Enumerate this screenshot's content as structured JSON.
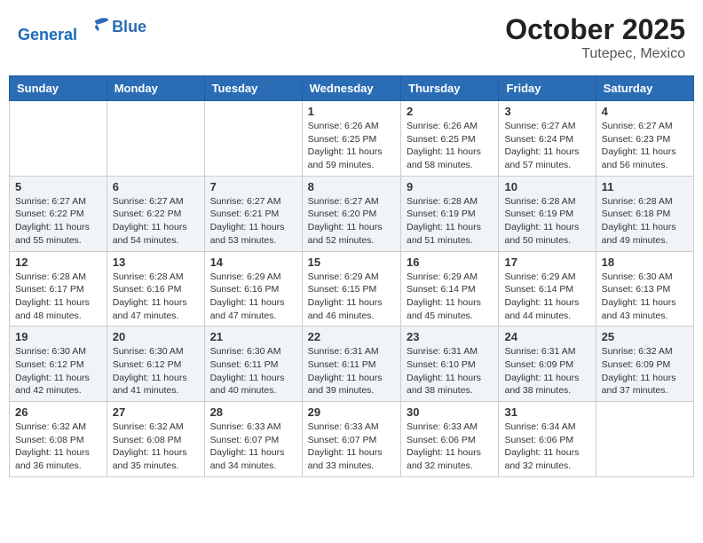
{
  "header": {
    "logo_line1": "General",
    "logo_line2": "Blue",
    "month": "October 2025",
    "location": "Tutepec, Mexico"
  },
  "weekdays": [
    "Sunday",
    "Monday",
    "Tuesday",
    "Wednesday",
    "Thursday",
    "Friday",
    "Saturday"
  ],
  "weeks": [
    [
      {
        "day": "",
        "info": ""
      },
      {
        "day": "",
        "info": ""
      },
      {
        "day": "",
        "info": ""
      },
      {
        "day": "1",
        "info": "Sunrise: 6:26 AM\nSunset: 6:25 PM\nDaylight: 11 hours and 59 minutes."
      },
      {
        "day": "2",
        "info": "Sunrise: 6:26 AM\nSunset: 6:25 PM\nDaylight: 11 hours and 58 minutes."
      },
      {
        "day": "3",
        "info": "Sunrise: 6:27 AM\nSunset: 6:24 PM\nDaylight: 11 hours and 57 minutes."
      },
      {
        "day": "4",
        "info": "Sunrise: 6:27 AM\nSunset: 6:23 PM\nDaylight: 11 hours and 56 minutes."
      }
    ],
    [
      {
        "day": "5",
        "info": "Sunrise: 6:27 AM\nSunset: 6:22 PM\nDaylight: 11 hours and 55 minutes."
      },
      {
        "day": "6",
        "info": "Sunrise: 6:27 AM\nSunset: 6:22 PM\nDaylight: 11 hours and 54 minutes."
      },
      {
        "day": "7",
        "info": "Sunrise: 6:27 AM\nSunset: 6:21 PM\nDaylight: 11 hours and 53 minutes."
      },
      {
        "day": "8",
        "info": "Sunrise: 6:27 AM\nSunset: 6:20 PM\nDaylight: 11 hours and 52 minutes."
      },
      {
        "day": "9",
        "info": "Sunrise: 6:28 AM\nSunset: 6:19 PM\nDaylight: 11 hours and 51 minutes."
      },
      {
        "day": "10",
        "info": "Sunrise: 6:28 AM\nSunset: 6:19 PM\nDaylight: 11 hours and 50 minutes."
      },
      {
        "day": "11",
        "info": "Sunrise: 6:28 AM\nSunset: 6:18 PM\nDaylight: 11 hours and 49 minutes."
      }
    ],
    [
      {
        "day": "12",
        "info": "Sunrise: 6:28 AM\nSunset: 6:17 PM\nDaylight: 11 hours and 48 minutes."
      },
      {
        "day": "13",
        "info": "Sunrise: 6:28 AM\nSunset: 6:16 PM\nDaylight: 11 hours and 47 minutes."
      },
      {
        "day": "14",
        "info": "Sunrise: 6:29 AM\nSunset: 6:16 PM\nDaylight: 11 hours and 47 minutes."
      },
      {
        "day": "15",
        "info": "Sunrise: 6:29 AM\nSunset: 6:15 PM\nDaylight: 11 hours and 46 minutes."
      },
      {
        "day": "16",
        "info": "Sunrise: 6:29 AM\nSunset: 6:14 PM\nDaylight: 11 hours and 45 minutes."
      },
      {
        "day": "17",
        "info": "Sunrise: 6:29 AM\nSunset: 6:14 PM\nDaylight: 11 hours and 44 minutes."
      },
      {
        "day": "18",
        "info": "Sunrise: 6:30 AM\nSunset: 6:13 PM\nDaylight: 11 hours and 43 minutes."
      }
    ],
    [
      {
        "day": "19",
        "info": "Sunrise: 6:30 AM\nSunset: 6:12 PM\nDaylight: 11 hours and 42 minutes."
      },
      {
        "day": "20",
        "info": "Sunrise: 6:30 AM\nSunset: 6:12 PM\nDaylight: 11 hours and 41 minutes."
      },
      {
        "day": "21",
        "info": "Sunrise: 6:30 AM\nSunset: 6:11 PM\nDaylight: 11 hours and 40 minutes."
      },
      {
        "day": "22",
        "info": "Sunrise: 6:31 AM\nSunset: 6:11 PM\nDaylight: 11 hours and 39 minutes."
      },
      {
        "day": "23",
        "info": "Sunrise: 6:31 AM\nSunset: 6:10 PM\nDaylight: 11 hours and 38 minutes."
      },
      {
        "day": "24",
        "info": "Sunrise: 6:31 AM\nSunset: 6:09 PM\nDaylight: 11 hours and 38 minutes."
      },
      {
        "day": "25",
        "info": "Sunrise: 6:32 AM\nSunset: 6:09 PM\nDaylight: 11 hours and 37 minutes."
      }
    ],
    [
      {
        "day": "26",
        "info": "Sunrise: 6:32 AM\nSunset: 6:08 PM\nDaylight: 11 hours and 36 minutes."
      },
      {
        "day": "27",
        "info": "Sunrise: 6:32 AM\nSunset: 6:08 PM\nDaylight: 11 hours and 35 minutes."
      },
      {
        "day": "28",
        "info": "Sunrise: 6:33 AM\nSunset: 6:07 PM\nDaylight: 11 hours and 34 minutes."
      },
      {
        "day": "29",
        "info": "Sunrise: 6:33 AM\nSunset: 6:07 PM\nDaylight: 11 hours and 33 minutes."
      },
      {
        "day": "30",
        "info": "Sunrise: 6:33 AM\nSunset: 6:06 PM\nDaylight: 11 hours and 32 minutes."
      },
      {
        "day": "31",
        "info": "Sunrise: 6:34 AM\nSunset: 6:06 PM\nDaylight: 11 hours and 32 minutes."
      },
      {
        "day": "",
        "info": ""
      }
    ]
  ]
}
